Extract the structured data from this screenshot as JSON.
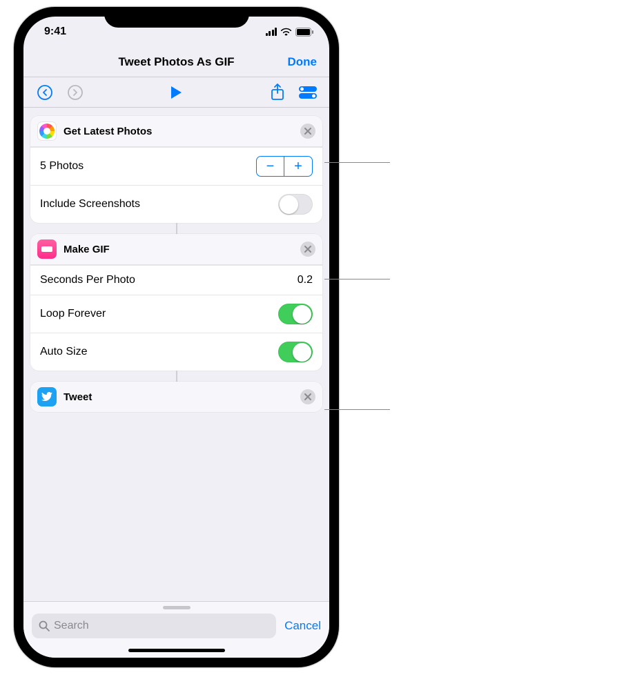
{
  "status": {
    "time": "9:41"
  },
  "nav": {
    "title": "Tweet Photos As GIF",
    "done": "Done"
  },
  "toolbar": {},
  "actions": [
    {
      "title": "Get Latest Photos",
      "rows": {
        "count_label": "5 Photos",
        "include_screenshots_label": "Include Screenshots",
        "include_screenshots_on": false
      }
    },
    {
      "title": "Make GIF",
      "rows": {
        "seconds_label": "Seconds Per Photo",
        "seconds_value": "0.2",
        "loop_label": "Loop Forever",
        "loop_on": true,
        "autosize_label": "Auto Size",
        "autosize_on": true
      }
    },
    {
      "title": "Tweet"
    }
  ],
  "search": {
    "placeholder": "Search",
    "cancel": "Cancel"
  }
}
